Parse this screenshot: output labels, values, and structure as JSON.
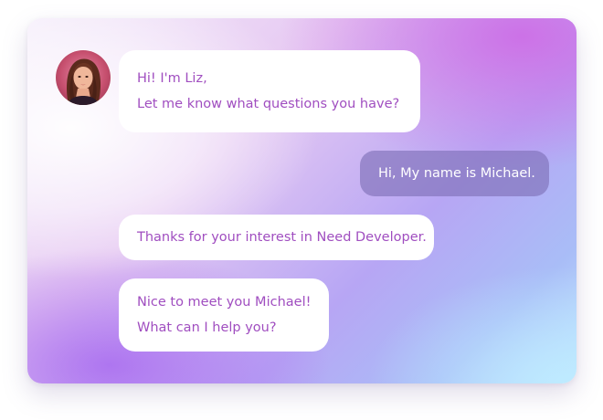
{
  "chat": {
    "agent": {
      "avatar_icon": "person-portrait"
    },
    "messages": [
      {
        "sender": "agent",
        "lines": [
          "Hi! I'm Liz,",
          "Let me know what questions you have?"
        ]
      },
      {
        "sender": "user",
        "lines": [
          "Hi, My name is Michael."
        ]
      },
      {
        "sender": "agent",
        "lines": [
          "Thanks for your interest in Need Developer."
        ]
      },
      {
        "sender": "agent",
        "lines": [
          "Nice to meet you Michael!",
          "What can I help you?"
        ]
      }
    ]
  },
  "colors": {
    "agent_text": "#a04ec0",
    "user_bubble": "#7d6eb4",
    "user_text": "#ffffff",
    "bubble_bg": "#ffffff"
  }
}
